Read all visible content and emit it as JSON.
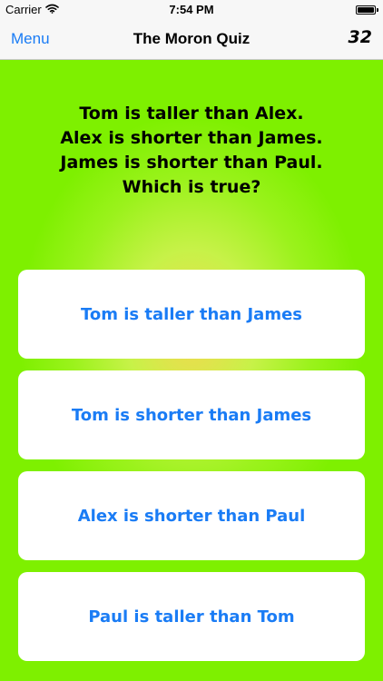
{
  "status_bar": {
    "carrier": "Carrier",
    "time": "7:54 PM",
    "wifi_icon": "wifi-icon",
    "battery_icon": "battery-icon",
    "battery_level": 1.0
  },
  "nav": {
    "menu_label": "Menu",
    "title": "The Moron Quiz",
    "score": "32"
  },
  "question": {
    "lines": [
      "Tom is taller than Alex.",
      "Alex is shorter than James.",
      "James is shorter than Paul.",
      "Which is true?"
    ]
  },
  "answers": [
    {
      "label": "Tom is taller than James"
    },
    {
      "label": "Tom is shorter than James"
    },
    {
      "label": "Alex is shorter than Paul"
    },
    {
      "label": "Paul is taller than Tom"
    }
  ],
  "colors": {
    "accent": "#1a7cf5",
    "background": "#7ff000",
    "glow": "#f3d84f"
  }
}
